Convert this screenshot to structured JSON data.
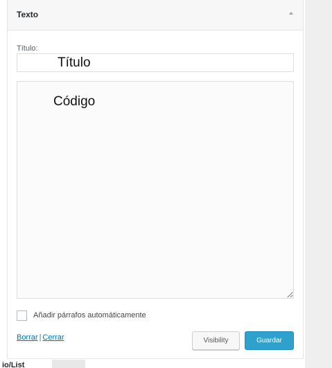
{
  "widget": {
    "title": "Texto",
    "title_label": "Título:",
    "title_value": "Título",
    "code_value": "Código",
    "auto_paragraph_label": "Añadir párrafos automáticamente",
    "delete_link": "Borrar",
    "separator": "|",
    "close_link": "Cerrar",
    "visibility_button": "Visibility",
    "save_button": "Guardar"
  },
  "bottom": {
    "tab_label": "io/List"
  },
  "colors": {
    "accent": "#2ea2cc",
    "link": "#0073aa"
  }
}
